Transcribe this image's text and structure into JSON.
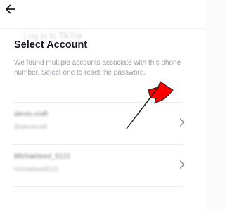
{
  "header": {
    "back_icon": "arrow-left-icon",
    "ghost_title": "Log in to TikTok"
  },
  "dialog": {
    "title": "Select Account",
    "description": "We found multiple accounts associate with this phone number. Select one to reset the password."
  },
  "accounts": [
    {
      "name": "alexis.craft",
      "username": "@alexiscraft",
      "chevron_icon": "chevron-right-icon"
    },
    {
      "name": "Michaelsoul_5121",
      "username": "michaelsoul5121",
      "chevron_icon": "chevron-right-icon"
    }
  ],
  "annotation": {
    "shape": "red-arrow",
    "color": "#ff0000",
    "outline": "#222222"
  }
}
